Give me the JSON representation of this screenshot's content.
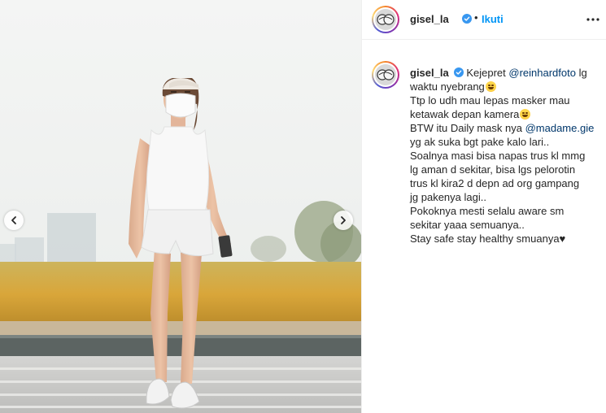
{
  "post": {
    "username": "gisel_la",
    "follow_separator": "•",
    "follow_label": "Ikuti",
    "caption": {
      "username": "gisel_la",
      "line1_prefix": "Kejepret ",
      "line1_mention": "@reinhardfoto",
      "line1_suffix": " lg",
      "line2": "waktu nyebrang",
      "line3": "Ttp lo udh mau lepas masker mau",
      "line4": "ketawak depan kamera",
      "line5_prefix": "BTW itu Daily mask nya ",
      "line5_mention": "@madame.gie",
      "line6": "yg ak suka bgt pake kalo lari..",
      "line7": "Soalnya masi bisa napas trus kl mmg",
      "line8": "lg aman d sekitar, bisa lgs pelorotin",
      "line9": "trus kl kira2 d depn ad org gampang",
      "line10": "jg pakenya lagi..",
      "line11": "Pokoknya mesti selalu aware sm",
      "line12": "sekitar yaaa semuanya..",
      "line13": "Stay safe stay healthy smuanya♥"
    }
  },
  "icons": {
    "verified": "verified-badge-icon",
    "more": "more-options-icon",
    "prev": "chevron-left-icon",
    "next": "chevron-right-icon",
    "emoji_grin": "grinning-sweat-emoji-icon",
    "emoji_rofl": "rolling-laughing-emoji-icon"
  },
  "colors": {
    "accent_blue": "#0095f6",
    "mention_blue": "#00376b",
    "text": "#262626",
    "divider": "#efefef"
  }
}
